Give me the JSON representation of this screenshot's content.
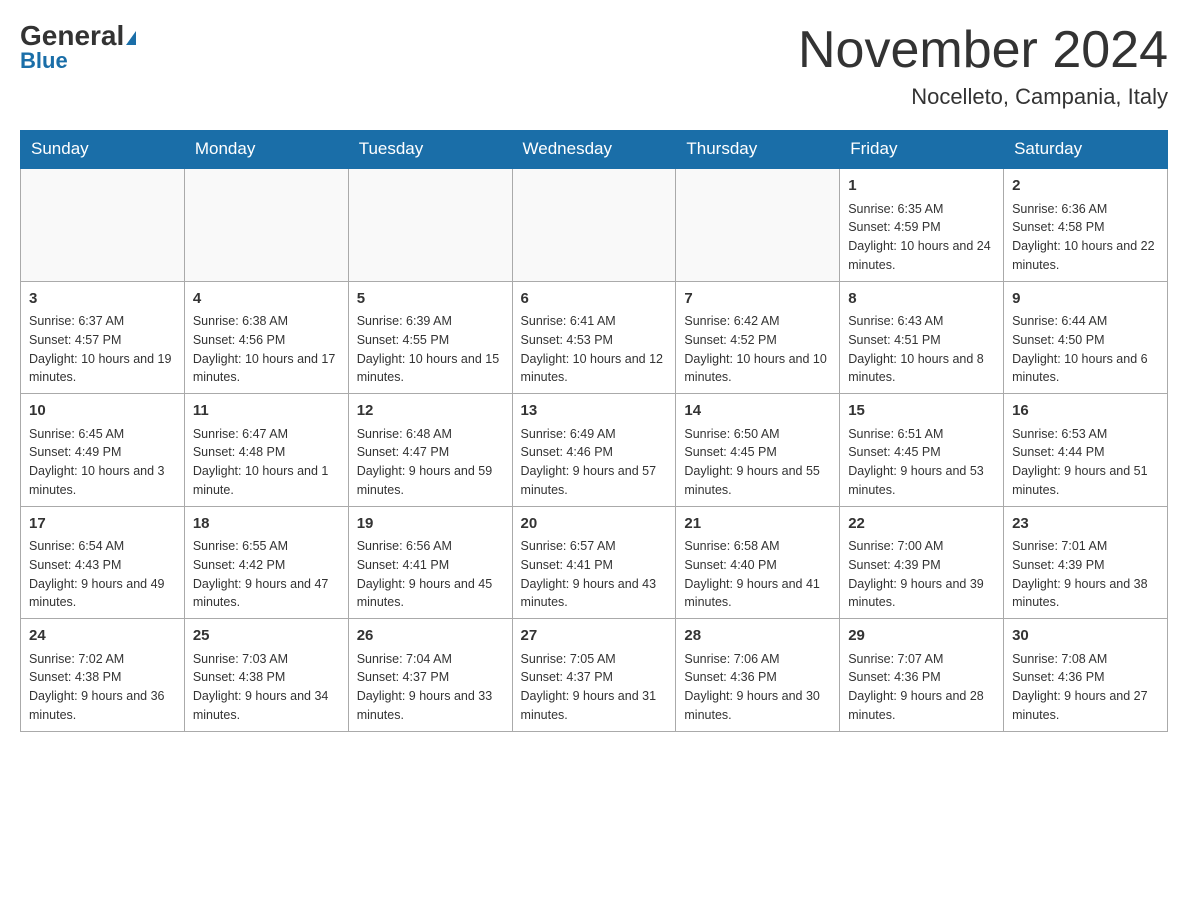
{
  "header": {
    "logo_general": "General",
    "logo_blue": "Blue",
    "month_title": "November 2024",
    "location": "Nocelleto, Campania, Italy"
  },
  "days_of_week": [
    "Sunday",
    "Monday",
    "Tuesday",
    "Wednesday",
    "Thursday",
    "Friday",
    "Saturday"
  ],
  "weeks": [
    [
      {
        "day": "",
        "info": ""
      },
      {
        "day": "",
        "info": ""
      },
      {
        "day": "",
        "info": ""
      },
      {
        "day": "",
        "info": ""
      },
      {
        "day": "",
        "info": ""
      },
      {
        "day": "1",
        "info": "Sunrise: 6:35 AM\nSunset: 4:59 PM\nDaylight: 10 hours and 24 minutes."
      },
      {
        "day": "2",
        "info": "Sunrise: 6:36 AM\nSunset: 4:58 PM\nDaylight: 10 hours and 22 minutes."
      }
    ],
    [
      {
        "day": "3",
        "info": "Sunrise: 6:37 AM\nSunset: 4:57 PM\nDaylight: 10 hours and 19 minutes."
      },
      {
        "day": "4",
        "info": "Sunrise: 6:38 AM\nSunset: 4:56 PM\nDaylight: 10 hours and 17 minutes."
      },
      {
        "day": "5",
        "info": "Sunrise: 6:39 AM\nSunset: 4:55 PM\nDaylight: 10 hours and 15 minutes."
      },
      {
        "day": "6",
        "info": "Sunrise: 6:41 AM\nSunset: 4:53 PM\nDaylight: 10 hours and 12 minutes."
      },
      {
        "day": "7",
        "info": "Sunrise: 6:42 AM\nSunset: 4:52 PM\nDaylight: 10 hours and 10 minutes."
      },
      {
        "day": "8",
        "info": "Sunrise: 6:43 AM\nSunset: 4:51 PM\nDaylight: 10 hours and 8 minutes."
      },
      {
        "day": "9",
        "info": "Sunrise: 6:44 AM\nSunset: 4:50 PM\nDaylight: 10 hours and 6 minutes."
      }
    ],
    [
      {
        "day": "10",
        "info": "Sunrise: 6:45 AM\nSunset: 4:49 PM\nDaylight: 10 hours and 3 minutes."
      },
      {
        "day": "11",
        "info": "Sunrise: 6:47 AM\nSunset: 4:48 PM\nDaylight: 10 hours and 1 minute."
      },
      {
        "day": "12",
        "info": "Sunrise: 6:48 AM\nSunset: 4:47 PM\nDaylight: 9 hours and 59 minutes."
      },
      {
        "day": "13",
        "info": "Sunrise: 6:49 AM\nSunset: 4:46 PM\nDaylight: 9 hours and 57 minutes."
      },
      {
        "day": "14",
        "info": "Sunrise: 6:50 AM\nSunset: 4:45 PM\nDaylight: 9 hours and 55 minutes."
      },
      {
        "day": "15",
        "info": "Sunrise: 6:51 AM\nSunset: 4:45 PM\nDaylight: 9 hours and 53 minutes."
      },
      {
        "day": "16",
        "info": "Sunrise: 6:53 AM\nSunset: 4:44 PM\nDaylight: 9 hours and 51 minutes."
      }
    ],
    [
      {
        "day": "17",
        "info": "Sunrise: 6:54 AM\nSunset: 4:43 PM\nDaylight: 9 hours and 49 minutes."
      },
      {
        "day": "18",
        "info": "Sunrise: 6:55 AM\nSunset: 4:42 PM\nDaylight: 9 hours and 47 minutes."
      },
      {
        "day": "19",
        "info": "Sunrise: 6:56 AM\nSunset: 4:41 PM\nDaylight: 9 hours and 45 minutes."
      },
      {
        "day": "20",
        "info": "Sunrise: 6:57 AM\nSunset: 4:41 PM\nDaylight: 9 hours and 43 minutes."
      },
      {
        "day": "21",
        "info": "Sunrise: 6:58 AM\nSunset: 4:40 PM\nDaylight: 9 hours and 41 minutes."
      },
      {
        "day": "22",
        "info": "Sunrise: 7:00 AM\nSunset: 4:39 PM\nDaylight: 9 hours and 39 minutes."
      },
      {
        "day": "23",
        "info": "Sunrise: 7:01 AM\nSunset: 4:39 PM\nDaylight: 9 hours and 38 minutes."
      }
    ],
    [
      {
        "day": "24",
        "info": "Sunrise: 7:02 AM\nSunset: 4:38 PM\nDaylight: 9 hours and 36 minutes."
      },
      {
        "day": "25",
        "info": "Sunrise: 7:03 AM\nSunset: 4:38 PM\nDaylight: 9 hours and 34 minutes."
      },
      {
        "day": "26",
        "info": "Sunrise: 7:04 AM\nSunset: 4:37 PM\nDaylight: 9 hours and 33 minutes."
      },
      {
        "day": "27",
        "info": "Sunrise: 7:05 AM\nSunset: 4:37 PM\nDaylight: 9 hours and 31 minutes."
      },
      {
        "day": "28",
        "info": "Sunrise: 7:06 AM\nSunset: 4:36 PM\nDaylight: 9 hours and 30 minutes."
      },
      {
        "day": "29",
        "info": "Sunrise: 7:07 AM\nSunset: 4:36 PM\nDaylight: 9 hours and 28 minutes."
      },
      {
        "day": "30",
        "info": "Sunrise: 7:08 AM\nSunset: 4:36 PM\nDaylight: 9 hours and 27 minutes."
      }
    ]
  ]
}
